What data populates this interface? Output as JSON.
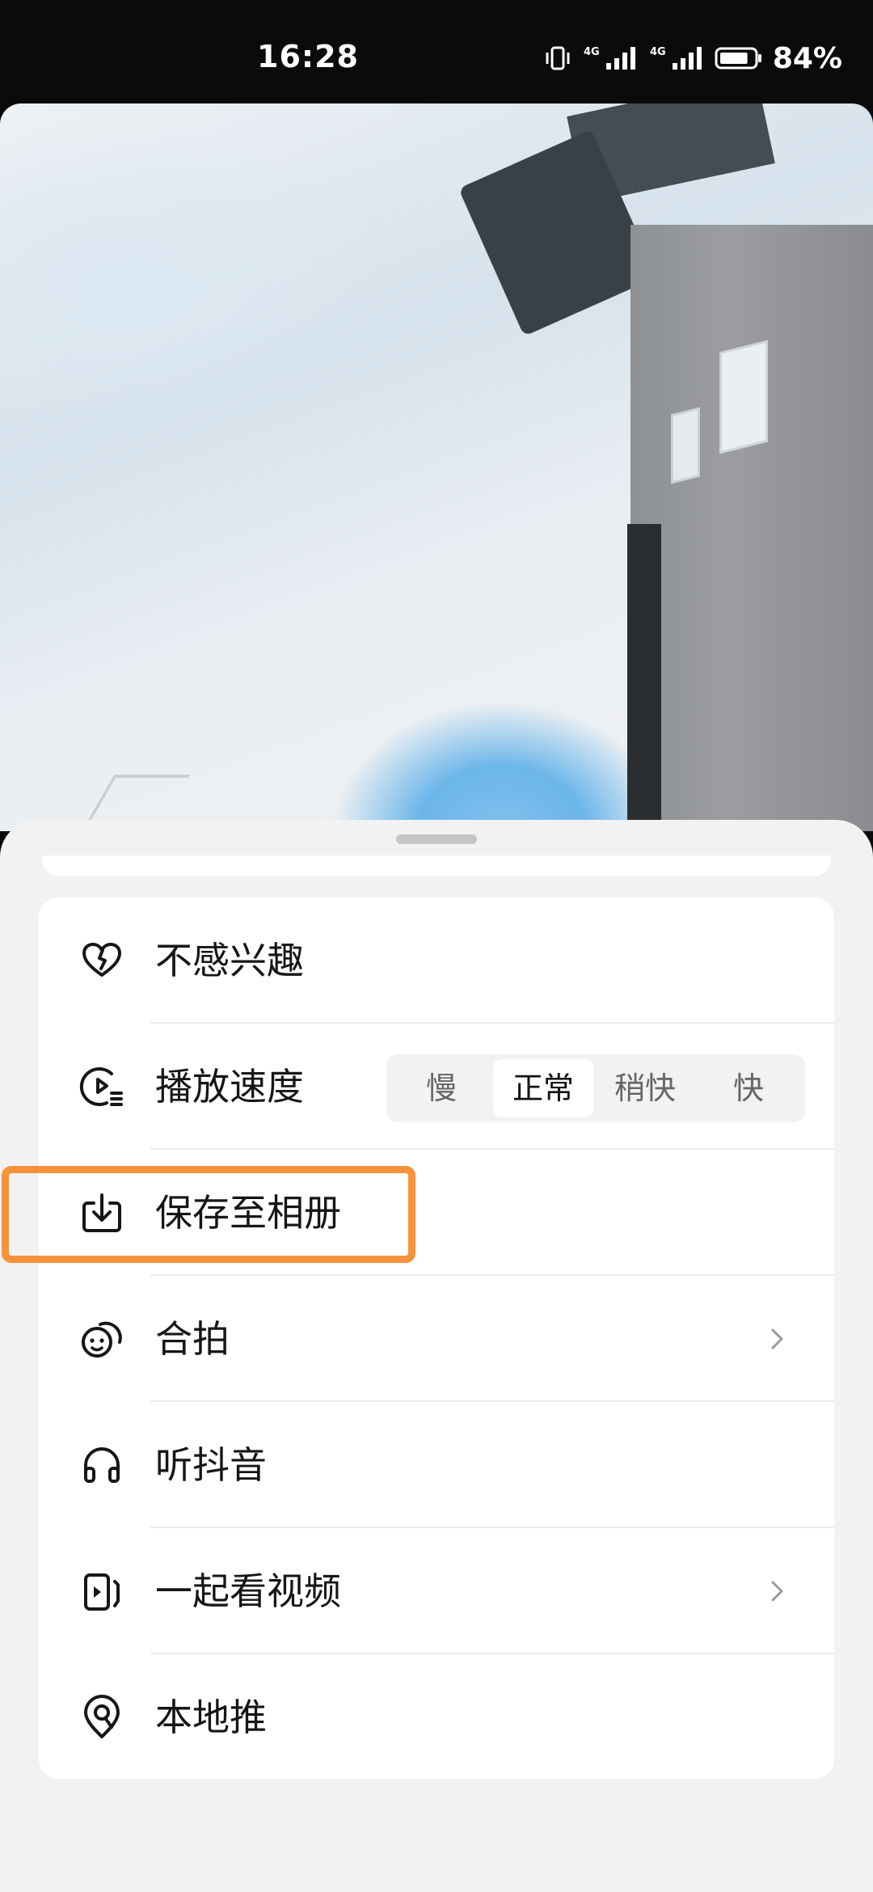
{
  "status_bar": {
    "time": "16:28",
    "network_1": "4G",
    "network_2": "4G",
    "battery_percent": "84%",
    "battery_level": 0.84
  },
  "menu": {
    "items": [
      {
        "label": "不感兴趣",
        "icon": "heart-broken-icon",
        "has_chevron": false
      },
      {
        "label": "播放速度",
        "icon": "playback-speed-icon",
        "has_chevron": false
      },
      {
        "label": "保存至相册",
        "icon": "download-icon",
        "has_chevron": false,
        "highlighted": true
      },
      {
        "label": "合拍",
        "icon": "duet-icon",
        "has_chevron": true
      },
      {
        "label": "听抖音",
        "icon": "headphones-icon",
        "has_chevron": false
      },
      {
        "label": "一起看视频",
        "icon": "watch-together-icon",
        "has_chevron": true
      },
      {
        "label": "本地推",
        "icon": "location-pin-icon",
        "has_chevron": false
      }
    ],
    "speed_options": [
      "慢",
      "正常",
      "稍快",
      "快"
    ],
    "speed_selected": "正常"
  },
  "colors": {
    "highlight": "#f7923a",
    "sheet_bg": "#f2f2f2",
    "card_bg": "#ffffff",
    "text": "#161616"
  }
}
